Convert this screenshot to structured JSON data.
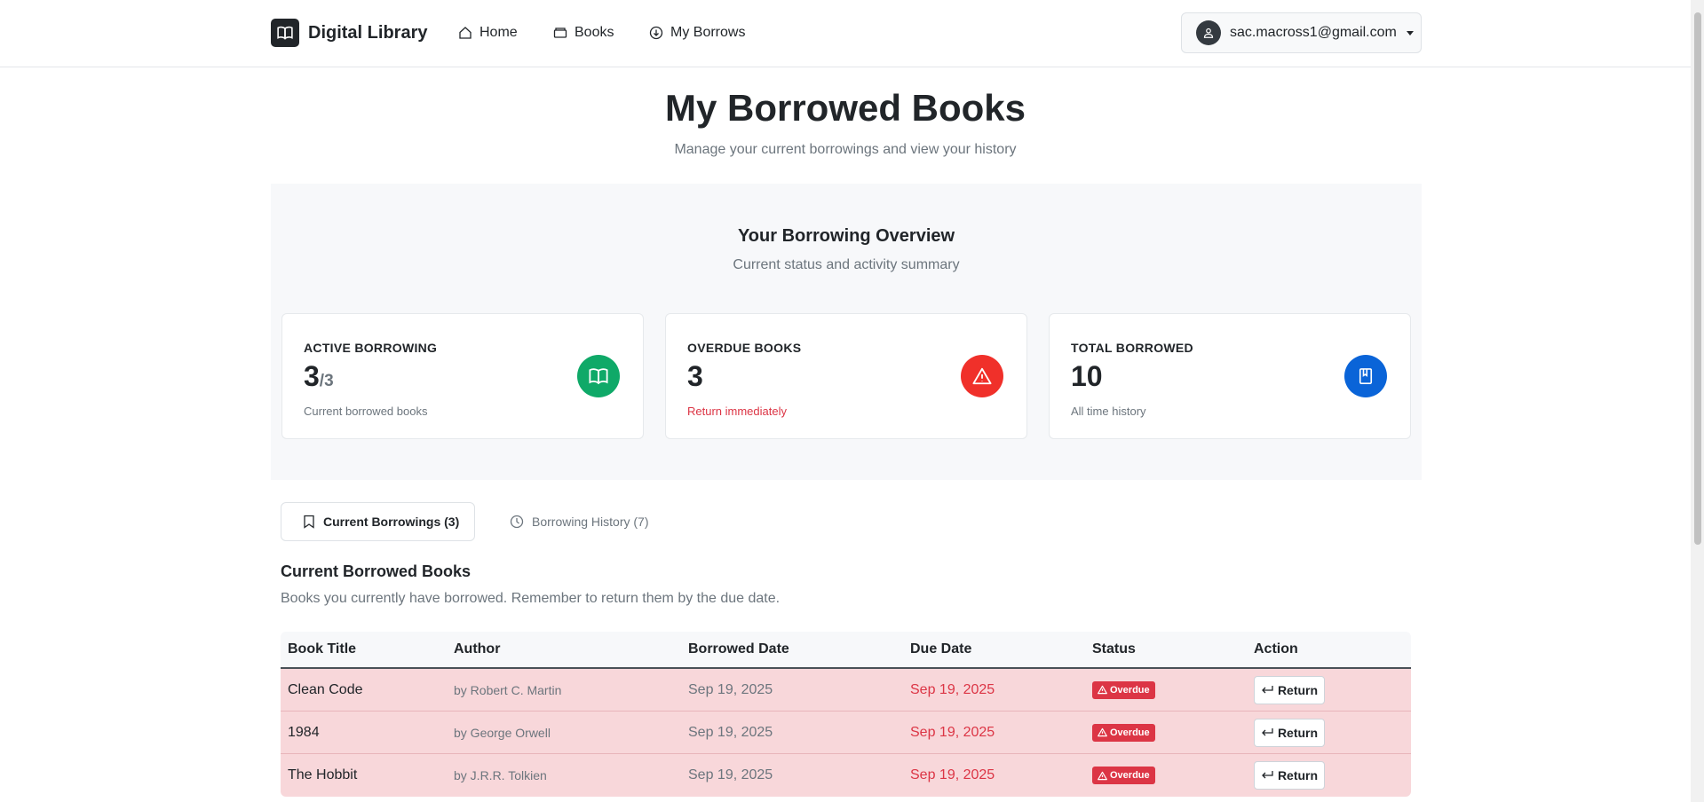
{
  "nav": {
    "brand": "Digital Library",
    "links": [
      {
        "label": "Home",
        "icon": "home-icon"
      },
      {
        "label": "Books",
        "icon": "books-icon"
      },
      {
        "label": "My Borrows",
        "icon": "download-circle-icon"
      }
    ],
    "user_email": "sac.macross1@gmail.com"
  },
  "header": {
    "title": "My Borrowed Books",
    "subtitle": "Manage your current borrowings and view your history"
  },
  "overview": {
    "title": "Your Borrowing Overview",
    "subtitle": "Current status and activity summary",
    "cards": [
      {
        "label": "ACTIVE BORROWING",
        "value": "3",
        "suffix": "/3",
        "note": "Current borrowed books",
        "color": "#0fa968",
        "icon": "book-open-icon"
      },
      {
        "label": "OVERDUE BOOKS",
        "value": "3",
        "suffix": "",
        "note": "Return immediately",
        "color": "#f0302a",
        "icon": "warning-icon"
      },
      {
        "label": "TOTAL BORROWED",
        "value": "10",
        "suffix": "",
        "note": "All time history",
        "color": "#0a64d8",
        "icon": "journal-icon"
      }
    ]
  },
  "tabs": [
    {
      "label": "Current Borrowings (3)",
      "icon": "bookmark-icon",
      "active": true
    },
    {
      "label": "Borrowing History (7)",
      "icon": "clock-icon",
      "active": false
    }
  ],
  "section": {
    "title": "Current Borrowed Books",
    "subtitle": "Books you currently have borrowed. Remember to return them by the due date."
  },
  "table": {
    "headers": [
      "Book Title",
      "Author",
      "Borrowed Date",
      "Due Date",
      "Status",
      "Action"
    ],
    "rows": [
      {
        "title": "Clean Code",
        "author": "by Robert C. Martin",
        "borrowed": "Sep 19, 2025",
        "due": "Sep 19, 2025",
        "status": "Overdue",
        "action": "Return"
      },
      {
        "title": "1984",
        "author": "by George Orwell",
        "borrowed": "Sep 19, 2025",
        "due": "Sep 19, 2025",
        "status": "Overdue",
        "action": "Return"
      },
      {
        "title": "The Hobbit",
        "author": "by J.R.R. Tolkien",
        "borrowed": "Sep 19, 2025",
        "due": "Sep 19, 2025",
        "status": "Overdue",
        "action": "Return"
      }
    ]
  },
  "colors": {
    "danger": "#dc3545",
    "overdue_row": "#f8d7da",
    "success": "#0fa968",
    "primary": "#0a64d8"
  }
}
